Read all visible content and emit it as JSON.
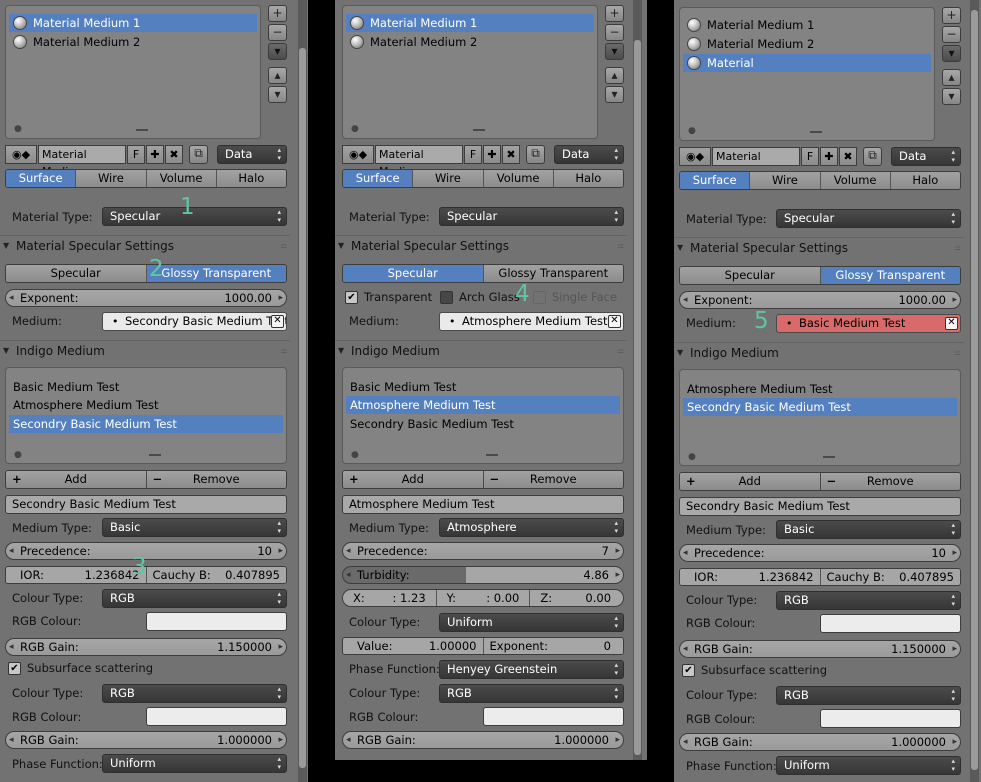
{
  "panels": [
    {
      "material_slots": [
        "Material Medium 1",
        "Material Medium 2"
      ],
      "selected_slot": 0,
      "material_name": "Material Medi...",
      "fake_user": "F",
      "link": "Data",
      "tabs": [
        "Surface",
        "Wire",
        "Volume",
        "Halo"
      ],
      "active_tab": 0,
      "material_type_label": "Material Type:",
      "material_type": "Specular",
      "spec_header": "Material Specular Settings",
      "spec_tabs": [
        "Specular",
        "Glossy Transparent"
      ],
      "spec_active": 1,
      "exponent_label": "Exponent:",
      "exponent": "1000.00",
      "medium_label": "Medium:",
      "medium_value": "Secondry Basic Medium Test",
      "indigo_header": "Indigo Medium",
      "media": [
        "Basic Medium Test",
        "Atmosphere Medium Test",
        "Secondry Basic Medium Test"
      ],
      "media_selected": 2,
      "add": "Add",
      "remove": "Remove",
      "selected_name": "Secondry Basic Medium Test",
      "medium_type_label": "Medium Type:",
      "medium_type": "Basic",
      "precedence_label": "Precedence:",
      "precedence": "10",
      "ior_label": "IOR:",
      "ior": "1.236842",
      "cauchy_label": "Cauchy B:",
      "cauchy": "0.407895",
      "colour_type_label": "Colour Type:",
      "colour_type": "RGB",
      "rgb_colour_label": "RGB Colour:",
      "rgb_gain_label": "RGB Gain:",
      "rgb_gain": "1.150000",
      "sss_label": "Subsurface scattering",
      "colour_type2_label": "Colour Type:",
      "colour_type2": "RGB",
      "rgb_colour2_label": "RGB Colour:",
      "rgb_gain2_label": "RGB Gain:",
      "rgb_gain2": "1.000000",
      "phase_label": "Phase Function:",
      "phase": "Uniform"
    },
    {
      "material_slots": [
        "Material Medium 1",
        "Material Medium 2"
      ],
      "selected_slot": 0,
      "material_name": "Material Medi...",
      "fake_user": "F",
      "link": "Data",
      "tabs": [
        "Surface",
        "Wire",
        "Volume",
        "Halo"
      ],
      "active_tab": 0,
      "material_type_label": "Material Type:",
      "material_type": "Specular",
      "spec_header": "Material Specular Settings",
      "spec_tabs": [
        "Specular",
        "Glossy Transparent"
      ],
      "spec_active": 0,
      "transparent_label": "Transparent",
      "arch_glass_label": "Arch Glass",
      "single_face_label": "Single Face",
      "medium_label": "Medium:",
      "medium_value": "Atmosphere Medium Test",
      "indigo_header": "Indigo Medium",
      "media": [
        "Basic Medium Test",
        "Atmosphere Medium Test",
        "Secondry Basic Medium Test"
      ],
      "media_selected": 1,
      "add": "Add",
      "remove": "Remove",
      "selected_name": "Atmosphere Medium Test",
      "medium_type_label": "Medium Type:",
      "medium_type": "Atmosphere",
      "precedence_label": "Precedence:",
      "precedence": "7",
      "turbidity_label": "Turbidity:",
      "turbidity": "4.86",
      "x_label": "X:",
      "x": ": 1.23",
      "y_label": "Y:",
      "y": ": 0.00",
      "z_label": "Z:",
      "z": "0.00",
      "colour_type_label": "Colour Type:",
      "colour_type": "Uniform",
      "value_label": "Value:",
      "value": "1.00000",
      "exponent_label": "Exponent:",
      "exponent": "0",
      "phase_label": "Phase Function:",
      "phase": "Henyey Greenstein",
      "colour_type2_label": "Colour Type:",
      "colour_type2": "RGB",
      "rgb_colour_label": "RGB Colour:",
      "rgb_gain_label": "RGB Gain:",
      "rgb_gain": "1.000000"
    },
    {
      "material_slots": [
        "Material Medium 1",
        "Material Medium 2",
        "Material"
      ],
      "selected_slot": 2,
      "material_name": "Material",
      "fake_user": "F",
      "link": "Data",
      "tabs": [
        "Surface",
        "Wire",
        "Volume",
        "Halo"
      ],
      "active_tab": 0,
      "material_type_label": "Material Type:",
      "material_type": "Specular",
      "spec_header": "Material Specular Settings",
      "spec_tabs": [
        "Specular",
        "Glossy Transparent"
      ],
      "spec_active": 1,
      "exponent_label": "Exponent:",
      "exponent": "1000.00",
      "medium_label": "Medium:",
      "medium_value": "Basic Medium Test",
      "indigo_header": "Indigo Medium",
      "media": [
        "Atmosphere Medium Test",
        "Secondry Basic Medium Test"
      ],
      "media_selected": 1,
      "add": "Add",
      "remove": "Remove",
      "selected_name": "Secondry Basic Medium Test",
      "medium_type_label": "Medium Type:",
      "medium_type": "Basic",
      "precedence_label": "Precedence:",
      "precedence": "10",
      "ior_label": "IOR:",
      "ior": "1.236842",
      "cauchy_label": "Cauchy B:",
      "cauchy": "0.407895",
      "colour_type_label": "Colour Type:",
      "colour_type": "RGB",
      "rgb_colour_label": "RGB Colour:",
      "rgb_gain_label": "RGB Gain:",
      "rgb_gain": "1.150000",
      "sss_label": "Subsurface scattering",
      "colour_type2_label": "Colour Type:",
      "colour_type2": "RGB",
      "rgb_colour2_label": "RGB Colour:",
      "rgb_gain2_label": "RGB Gain:",
      "rgb_gain2": "1.000000",
      "phase_label": "Phase Function:",
      "phase": "Uniform"
    }
  ],
  "annotations": [
    "1",
    "2",
    "3",
    "4",
    "5"
  ],
  "colors": {
    "selection": "#5580bf",
    "panel": "#727272",
    "error_field": "#d86a6a",
    "annotation": "#61c4a4"
  }
}
